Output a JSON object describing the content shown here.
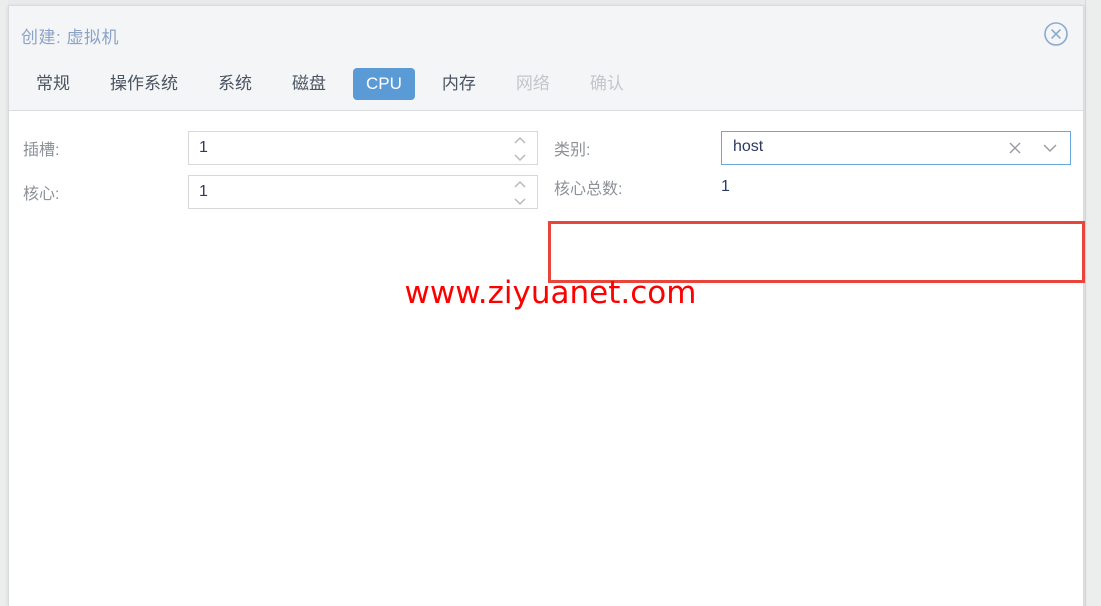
{
  "dialog": {
    "title": "创建: 虚拟机",
    "close_icon": "close-circle-icon"
  },
  "tabs": [
    {
      "label": "常规",
      "state": "normal"
    },
    {
      "label": "操作系统",
      "state": "normal"
    },
    {
      "label": "系统",
      "state": "normal"
    },
    {
      "label": "磁盘",
      "state": "normal"
    },
    {
      "label": "CPU",
      "state": "active"
    },
    {
      "label": "内存",
      "state": "normal"
    },
    {
      "label": "网络",
      "state": "disabled"
    },
    {
      "label": "确认",
      "state": "disabled"
    }
  ],
  "form": {
    "sockets": {
      "label": "插槽:",
      "value": "1",
      "placeholder": "",
      "spinner_up_icon": "chevron-up-icon",
      "spinner_down_icon": "chevron-down-icon"
    },
    "cores": {
      "label": "核心:",
      "value": "1",
      "placeholder": "",
      "spinner_up_icon": "chevron-up-icon",
      "spinner_down_icon": "chevron-down-icon"
    },
    "type": {
      "label": "类别:",
      "value": "host",
      "clear_icon": "clear-x-icon",
      "arrow_icon": "chevron-down-icon"
    },
    "total_cores": {
      "label": "核心总数:",
      "value": "1"
    }
  },
  "annotation": {
    "highlight_color": "#e8453c"
  },
  "watermark": {
    "text": "www.ziyuanet.com",
    "color": "#fe0000"
  },
  "colors": {
    "accent_blue": "#5b9bd5",
    "title_blue": "#8ba3c7",
    "header_bg": "#f4f5f7",
    "label_gray": "#8d9298",
    "disabled_gray": "#c3c6cb",
    "value_navy": "#2b3a62",
    "focus_border": "#6aa8e0"
  }
}
